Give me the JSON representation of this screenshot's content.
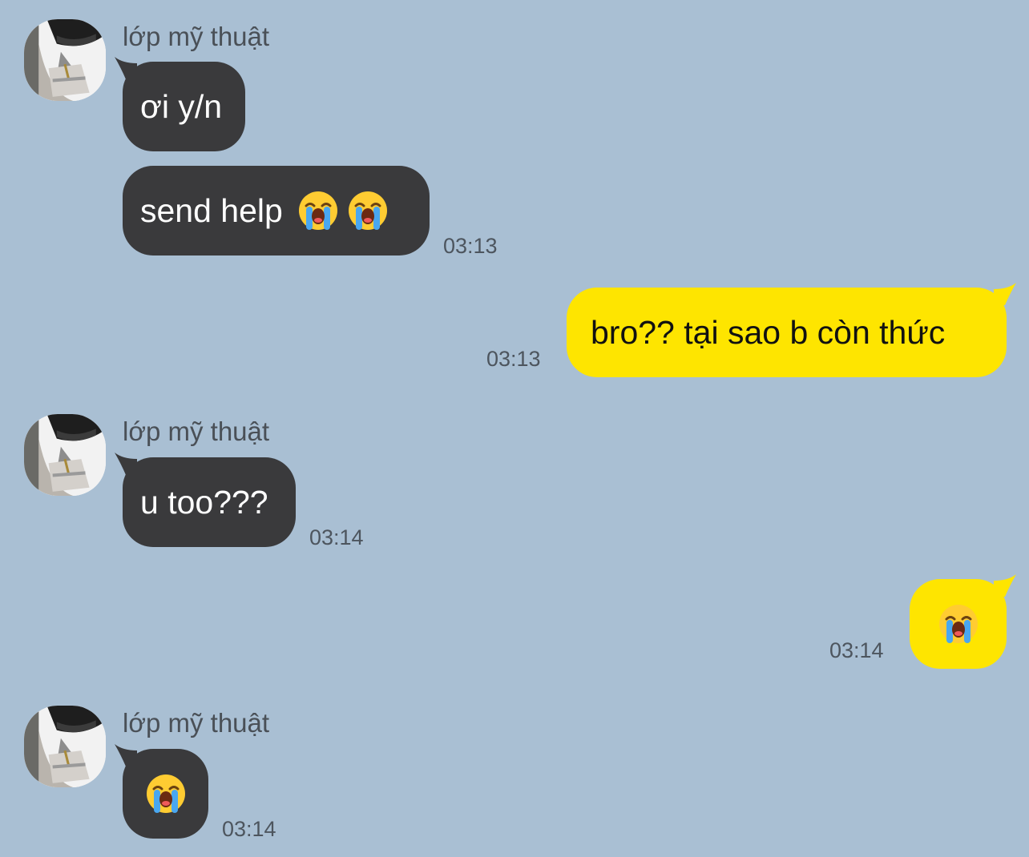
{
  "chat": {
    "background_color": "#a9bfd3",
    "received_bubble_color": "#3a3a3c",
    "sent_bubble_color": "#fee500",
    "messages": [
      {
        "sender": "lớp mỹ thuật",
        "text": "ơi y/n"
      },
      {
        "sender": "lớp mỹ thuật",
        "text": "send help",
        "emojis": [
          "loudly-crying-face-icon",
          "loudly-crying-face-icon"
        ],
        "time": "03:13"
      },
      {
        "sender": "me",
        "text": "bro?? tại sao b còn thức",
        "time": "03:13"
      },
      {
        "sender": "lớp mỹ thuật",
        "text": "u too???",
        "time": "03:14"
      },
      {
        "sender": "me",
        "emojis": [
          "loudly-crying-face-icon"
        ],
        "time": "03:14"
      },
      {
        "sender": "lớp mỹ thuật",
        "emojis": [
          "loudly-crying-face-icon"
        ],
        "time": "03:14"
      }
    ]
  }
}
